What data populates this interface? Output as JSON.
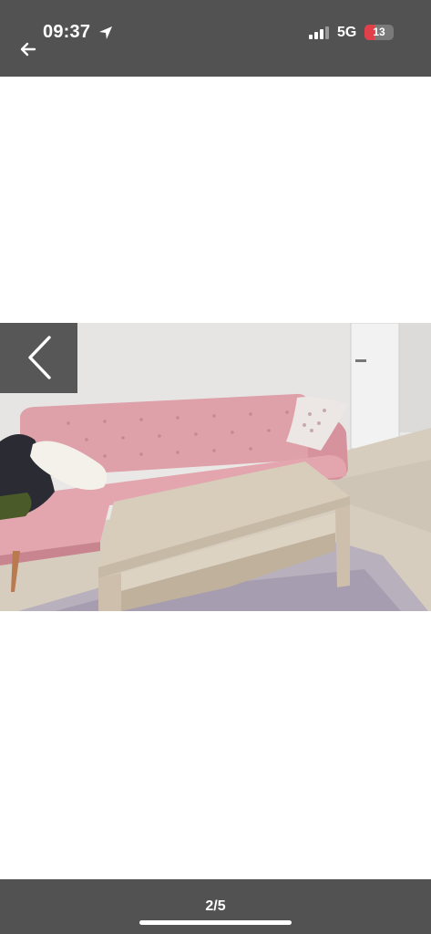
{
  "status_bar": {
    "time": "09:37",
    "network": "5G",
    "battery": "13",
    "battery_level": 0.13
  },
  "icons": {
    "back": "back-arrow-icon",
    "location": "location-arrow-icon",
    "signal": "signal-bars-icon",
    "prev": "chevron-left-icon"
  },
  "gallery": {
    "counter": "2/5"
  },
  "colors": {
    "bar_background": "#525252",
    "battery_low": "#e0404a",
    "sofa_pink": "#dfa3ac"
  }
}
